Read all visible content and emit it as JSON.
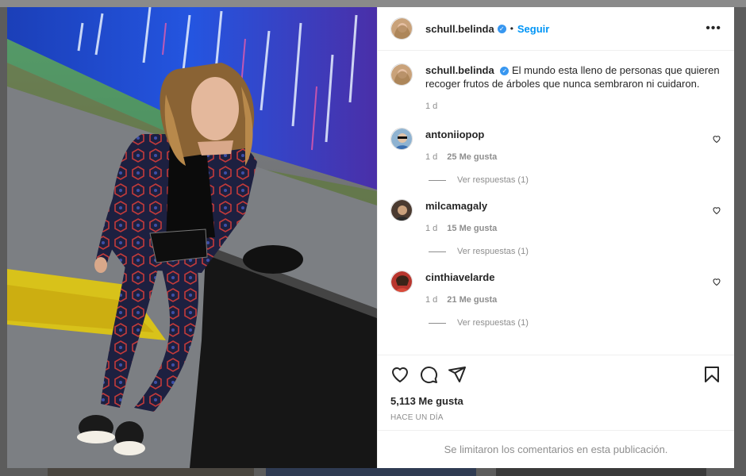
{
  "post": {
    "username": "schull.belinda",
    "verified_symbol": "✓",
    "separator": "•",
    "follow_label": "Seguir",
    "more_label": "•••",
    "caption_text": "El mundo esta lleno de personas que quieren recoger frutos de árboles que nunca sembraron ni cuidaron.",
    "caption_time": "1 d",
    "likes": "5,113 Me gusta",
    "date": "HACE UN DÍA",
    "comments_limited": "Se limitaron los comentarios en esta publicación."
  },
  "comments": [
    {
      "username": "antoniiopop",
      "text": "",
      "time": "1 d",
      "likes": "25 Me gusta",
      "replies": "Ver respuestas (1)"
    },
    {
      "username": "milcamagaly",
      "text": "",
      "time": "1 d",
      "likes": "15 Me gusta",
      "replies": "Ver respuestas (1)"
    },
    {
      "username": "cinthiavelarde",
      "text": "",
      "time": "1 d",
      "likes": "21 Me gusta",
      "replies": "Ver respuestas (1)"
    }
  ],
  "icons": {
    "like": "heart-icon",
    "comment": "comment-icon",
    "share": "paper-plane-icon",
    "save": "bookmark-icon",
    "comment_like": "heart-icon",
    "more": "more-icon",
    "verified": "verified-badge-icon"
  },
  "colors": {
    "accent": "#0095f6",
    "verified": "#3897f0",
    "muted": "#8e8e8e",
    "text": "#262626"
  }
}
